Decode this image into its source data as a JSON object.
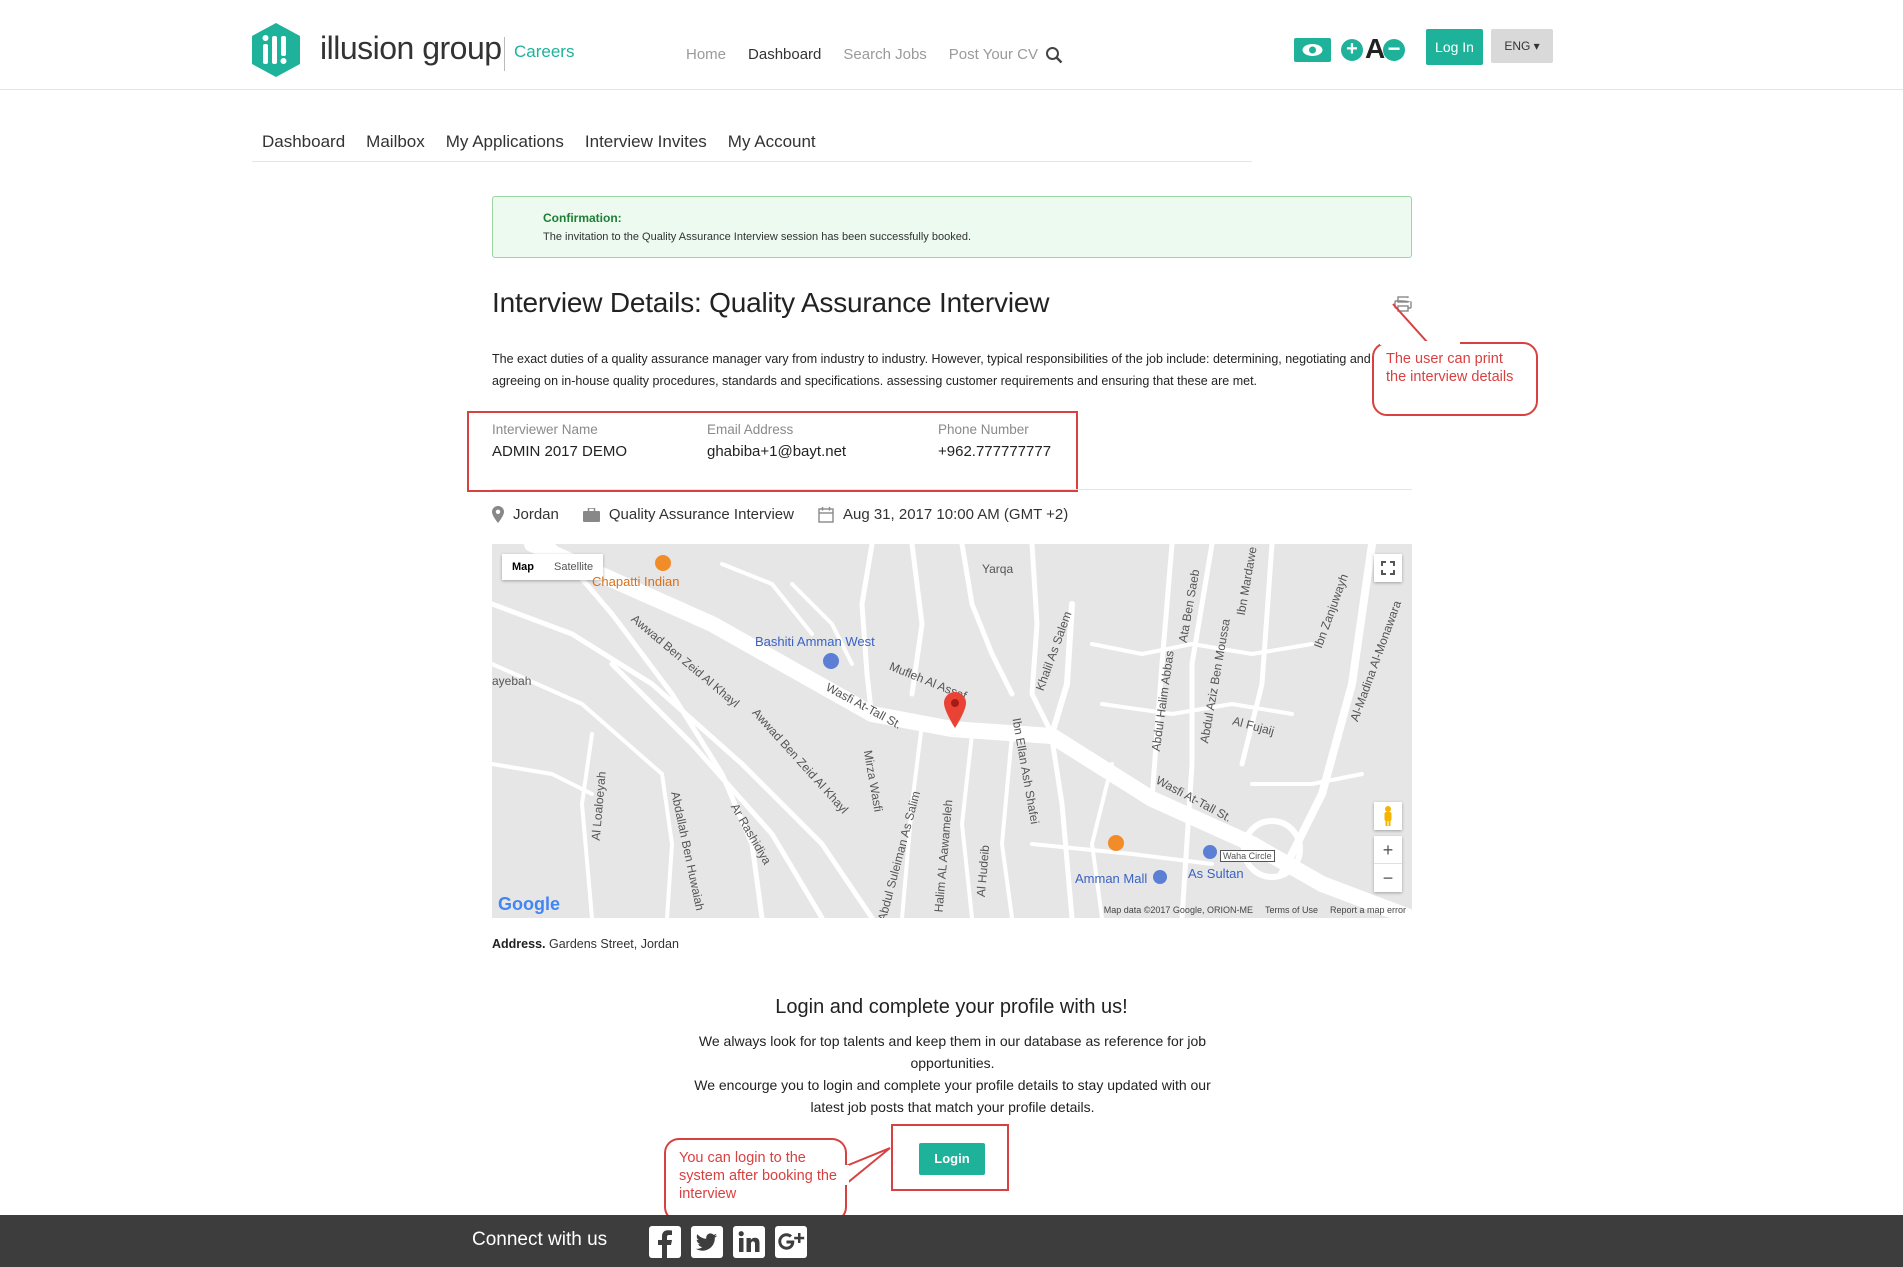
{
  "header": {
    "brand": "illusion group",
    "section": "Careers",
    "nav": [
      "Home",
      "Dashboard",
      "Search Jobs",
      "Post Your CV"
    ],
    "active_nav": "Dashboard",
    "font_bigger": "+",
    "font_letter": "A",
    "font_smaller": "−",
    "login": "Log In",
    "language": "ENG ▾",
    "accent": "#1fb29a"
  },
  "subnav": [
    "Dashboard",
    "Mailbox",
    "My Applications",
    "Interview Invites",
    "My Account"
  ],
  "confirmation": {
    "title": "Confirmation:",
    "message": "The invitation to the Quality Assurance Interview session has been successfully booked."
  },
  "interview": {
    "title": "Interview Details: Quality Assurance Interview",
    "description": "The exact duties of a quality assurance manager vary from industry to industry. However, typical responsibilities of the job include: determining, negotiating and agreeing on in-house quality procedures, standards and specifications. assessing customer requirements and ensuring that these are met.",
    "contact": {
      "name_label": "Interviewer Name",
      "name": "ADMIN 2017 DEMO",
      "email_label": "Email Address",
      "email": "ghabiba+1@bayt.net",
      "phone_label": "Phone Number",
      "phone": "+962.777777777"
    },
    "location": "Jordan",
    "job": "Quality Assurance Interview",
    "datetime": "Aug 31, 2017 10:00 AM (GMT +2)",
    "address_label": "Address.",
    "address": "Gardens Street, Jordan"
  },
  "map": {
    "type_map": "Map",
    "type_satellite": "Satellite",
    "labels": {
      "chapatti": "Chapatti Indian",
      "bashiti": "Bashiti Amman West",
      "mufleh": "Mufleh Al Assaf",
      "wasfi1": "Wasfi At-Tall St.",
      "wasfi2": "Wasfi At-Tall St.",
      "awwad1": "Awwad Ben Zeid Al Khayl",
      "awwad2": "Awwad Ben Zeid Al Khayl",
      "mirza": "Mirza Wasfi",
      "khalil": "Khalil As Salem",
      "abdulhalim": "Abdul Halim Abbas",
      "alfujaij": "Al Fujaij",
      "ibnellan": "Ibn Ellan Ash Shafei",
      "ammanmall": "Amman Mall",
      "assultan": "As Sultan",
      "waha": "Waha Circle",
      "ayyeah": "ayebah",
      "yarqa": "Yarqa",
      "aljuhair": "Al Loaloeyah",
      "abdallah": "Abdallah Ben Huwaiah",
      "rashidiya": "Ar Rashidiya",
      "sulieman": "Abdul Suleiman As Salim",
      "aawameleh": "Halim AL Aawameleh",
      "alhudeib": "Al Hudeib",
      "ibnzanjuwayh": "Ibn Zanjuwayh",
      "almadina": "Al-Madina Al-Monawara",
      "ataben": "Ata Ben Saeb",
      "ibnmardawe": "Ibn Mardawe",
      "yafiben": "Abdul Aziz Ben Moussa"
    },
    "google": "Google",
    "map_data": "Map data ©2017 Google, ORION-ME",
    "terms": "Terms of Use",
    "report": "Report a map error"
  },
  "cta": {
    "title": "Login and complete your profile with us!",
    "line1": "We always look for top talents and keep them in our database as reference for job opportunities.",
    "line2": "We encourge you to login and complete your profile details to stay updated with our latest job posts that match your profile details.",
    "button": "Login"
  },
  "callouts": {
    "print": "The user can print the interview details",
    "login": "You can login to the system after booking the interview",
    "color": "#d94040"
  },
  "footer": {
    "connect": "Connect with us",
    "social": [
      "facebook",
      "twitter",
      "linkedin",
      "google-plus"
    ]
  }
}
